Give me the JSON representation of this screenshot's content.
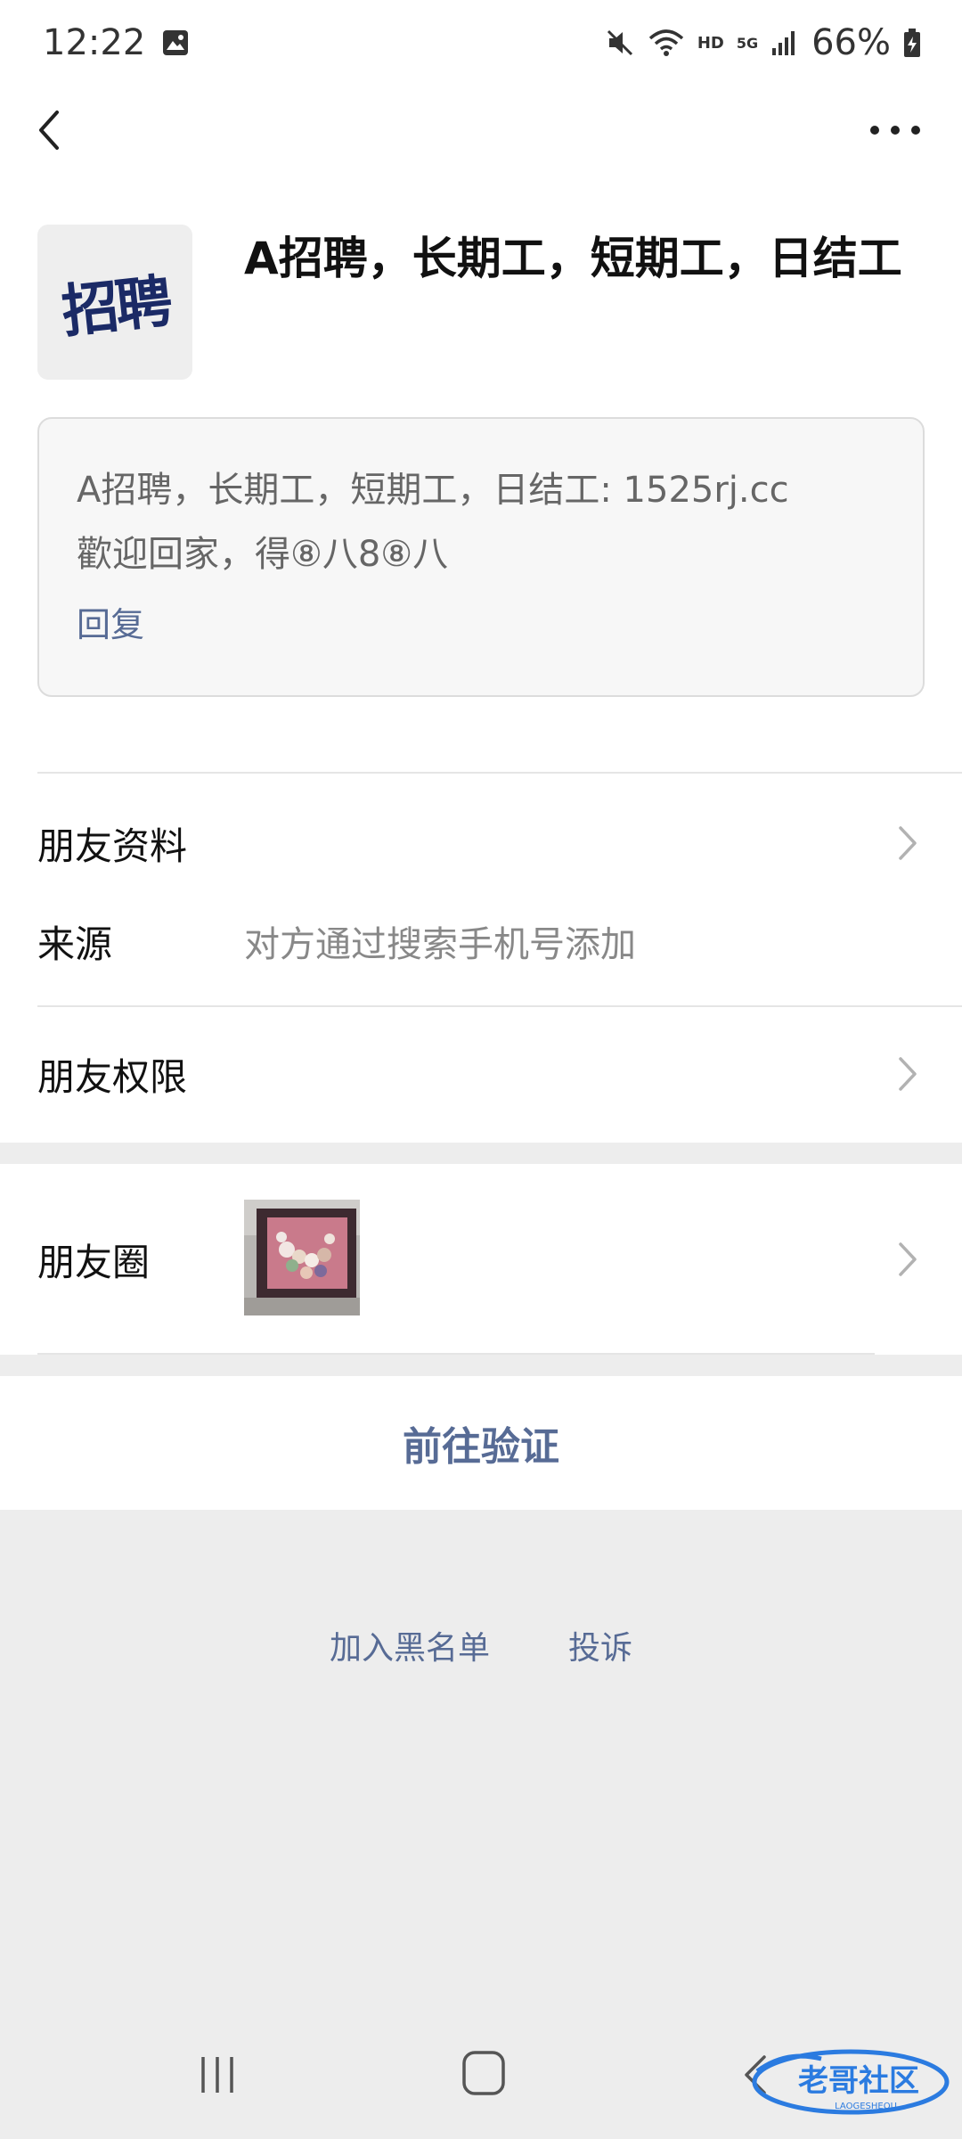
{
  "status_bar": {
    "time": "12:22",
    "battery": "66%",
    "network_hd": "HD",
    "network_5g": "5G"
  },
  "header": {
    "back_icon": "chevron-left-icon",
    "more_icon": "more-horizontal-icon"
  },
  "profile": {
    "avatar_text": "招聘",
    "name": "A招聘，长期工，短期工，日结工"
  },
  "message": {
    "text": "A招聘，长期工，短期工，日结工: 1525rj.cc\n歡迎回家，得⑧八8⑧八",
    "reply_label": "回复"
  },
  "rows": {
    "friend_info": "朋友资料",
    "source_label": "来源",
    "source_value": "对方通过搜索手机号添加",
    "permissions": "朋友权限",
    "moments": "朋友圈"
  },
  "actions": {
    "verify": "前往验证",
    "blacklist": "加入黑名单",
    "report": "投诉"
  },
  "watermark": {
    "text": "老哥社区",
    "sub": "LAOGESHEQU"
  },
  "colors": {
    "link": "#576b95",
    "background": "#ededed",
    "avatar_text": "#1b2a66"
  }
}
